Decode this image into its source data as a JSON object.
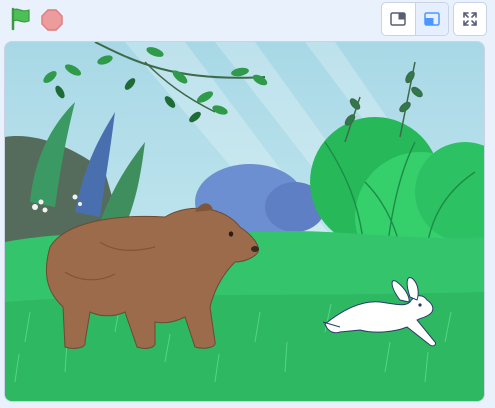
{
  "toolbar": {
    "green_flag": "green-flag-icon",
    "stop": "stop-sign-icon",
    "small_stage_mode": "small-stage-icon",
    "normal_stage_mode": "normal-stage-icon",
    "fullscreen": "fullscreen-icon"
  },
  "stage": {
    "sprites": [
      "bear",
      "hare"
    ]
  },
  "colors": {
    "flag_green": "#4cbf56",
    "stop_red": "#ec9c9c",
    "accent_blue": "#4c97ff",
    "grass": "#2fc46b",
    "bear_brown": "#9b6b4b",
    "hare_white": "#ffffff"
  }
}
